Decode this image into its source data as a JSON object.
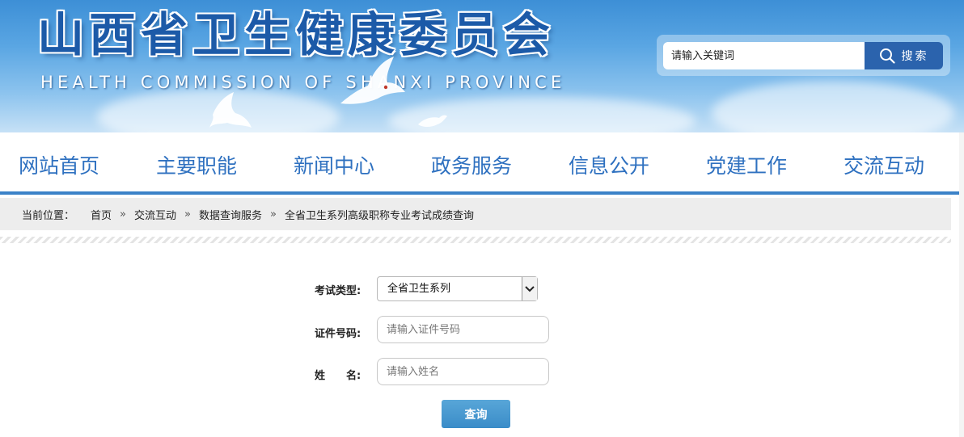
{
  "header": {
    "title_cn": "山西省卫生健康委员会",
    "title_en": "HEALTH COMMISSION OF SHANXI PROVINCE",
    "search_placeholder": "请输入关键词",
    "search_button": "搜索",
    "search_icon": "magnifier-icon"
  },
  "nav": {
    "items": [
      {
        "label": "网站首页"
      },
      {
        "label": "主要职能"
      },
      {
        "label": "新闻中心"
      },
      {
        "label": "政务服务"
      },
      {
        "label": "信息公开"
      },
      {
        "label": "党建工作"
      },
      {
        "label": "交流互动"
      }
    ]
  },
  "breadcrumb": {
    "prefix": "当前位置：",
    "separator": "»",
    "items": [
      "首页",
      "交流互动",
      "数据查询服务",
      "全省卫生系列高级职称专业考试成绩查询"
    ]
  },
  "form": {
    "exam_type_label": "考试类型:",
    "exam_type_value": "全省卫生系列",
    "id_label": "证件号码:",
    "id_placeholder": "请输入证件号码",
    "name_label": "姓　　名:",
    "name_placeholder": "请输入姓名",
    "submit_label": "查询"
  },
  "colors": {
    "nav_text": "#2f71c0",
    "nav_underline": "#3b82c8",
    "search_button": "#2b63ad",
    "query_button": "#3a8cc8",
    "title_text": "#1c5aa8"
  }
}
